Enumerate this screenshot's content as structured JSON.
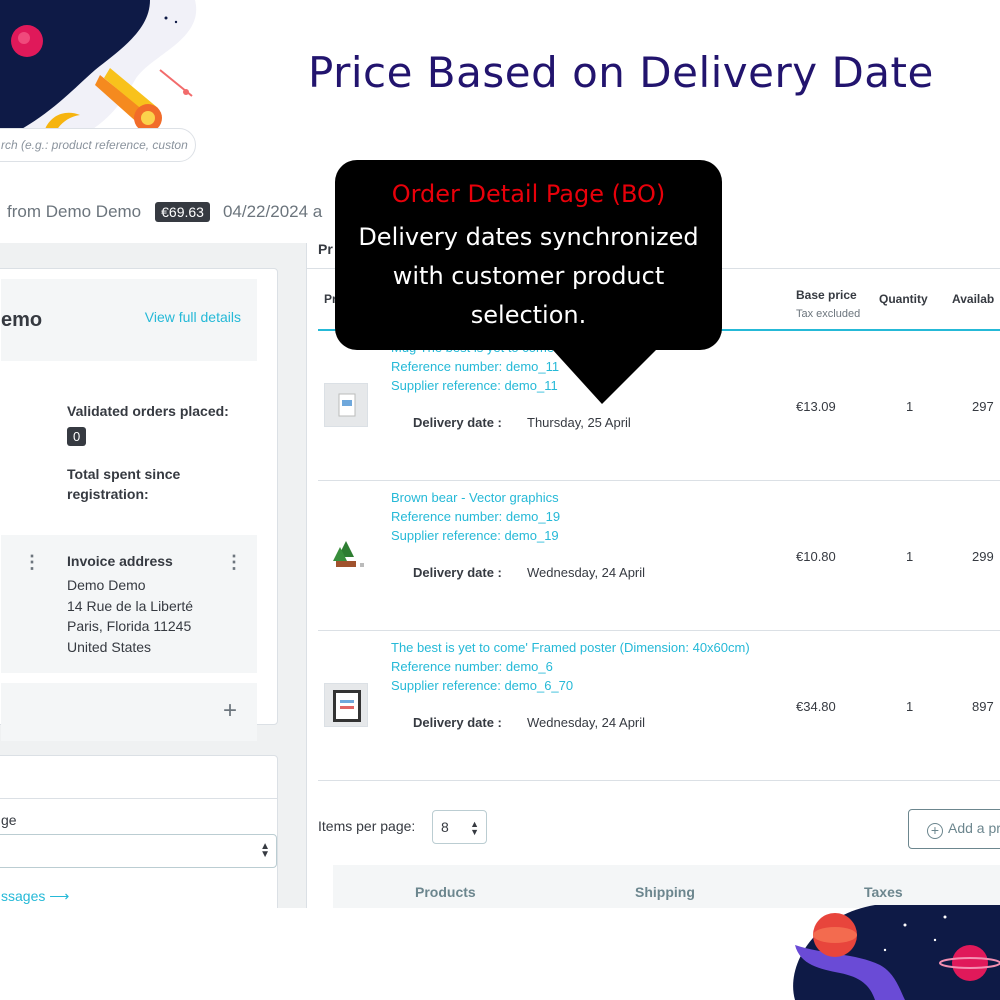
{
  "banner": {
    "title": "Price Based on Delivery Date"
  },
  "search": {
    "placeholder": "rch (e.g.: product reference, custon"
  },
  "order_header": {
    "from": "from Demo Demo",
    "total": "€69.63",
    "date": "04/22/2024 a"
  },
  "callout": {
    "title": "Order Detail Page (BO)",
    "body": "Delivery dates synchronized with customer product selection."
  },
  "customer": {
    "name": "emo",
    "view_details": "View full details",
    "validated_orders_label": "Validated orders placed:",
    "validated_orders_count": "0",
    "total_spent_label": "Total spent since registration:",
    "invoice_title": "Invoice address",
    "invoice_lines": [
      "Demo Demo",
      "14 Rue de la Liberté",
      "Paris, Florida 11245",
      "United States"
    ]
  },
  "messages": {
    "label": "ge",
    "link": "ssages ⟶"
  },
  "products": {
    "title": "Pr",
    "columns": {
      "product": "Pr",
      "base_price": "Base price",
      "base_price_sub": "Tax excluded",
      "quantity": "Quantity",
      "available": "Availab"
    },
    "delivery_label": "Delivery date :",
    "rows": [
      {
        "name": "Mug The best is yet to come",
        "reference": "Reference number: demo_11",
        "supplier": "Supplier reference: demo_11",
        "delivery": "Thursday, 25 April",
        "price": "€13.09",
        "quantity": "1",
        "available": "297"
      },
      {
        "name": "Brown bear - Vector graphics",
        "reference": "Reference number: demo_19",
        "supplier": "Supplier reference: demo_19",
        "delivery": "Wednesday, 24 April",
        "price": "€10.80",
        "quantity": "1",
        "available": "299"
      },
      {
        "name": "The best is yet to come' Framed poster (Dimension: 40x60cm)",
        "reference": "Reference number: demo_6",
        "supplier": "Supplier reference: demo_6_70",
        "delivery": "Wednesday, 24 April",
        "price": "€34.80",
        "quantity": "1",
        "available": "897"
      }
    ],
    "items_per_page_label": "Items per page:",
    "items_per_page_value": "8",
    "add_product_label": "Add a pr",
    "summary": {
      "products": "Products",
      "shipping": "Shipping",
      "taxes": "Taxes"
    }
  },
  "colors": {
    "accent": "#25b9d7",
    "title": "#22146e",
    "callout_title": "#e8000a"
  }
}
